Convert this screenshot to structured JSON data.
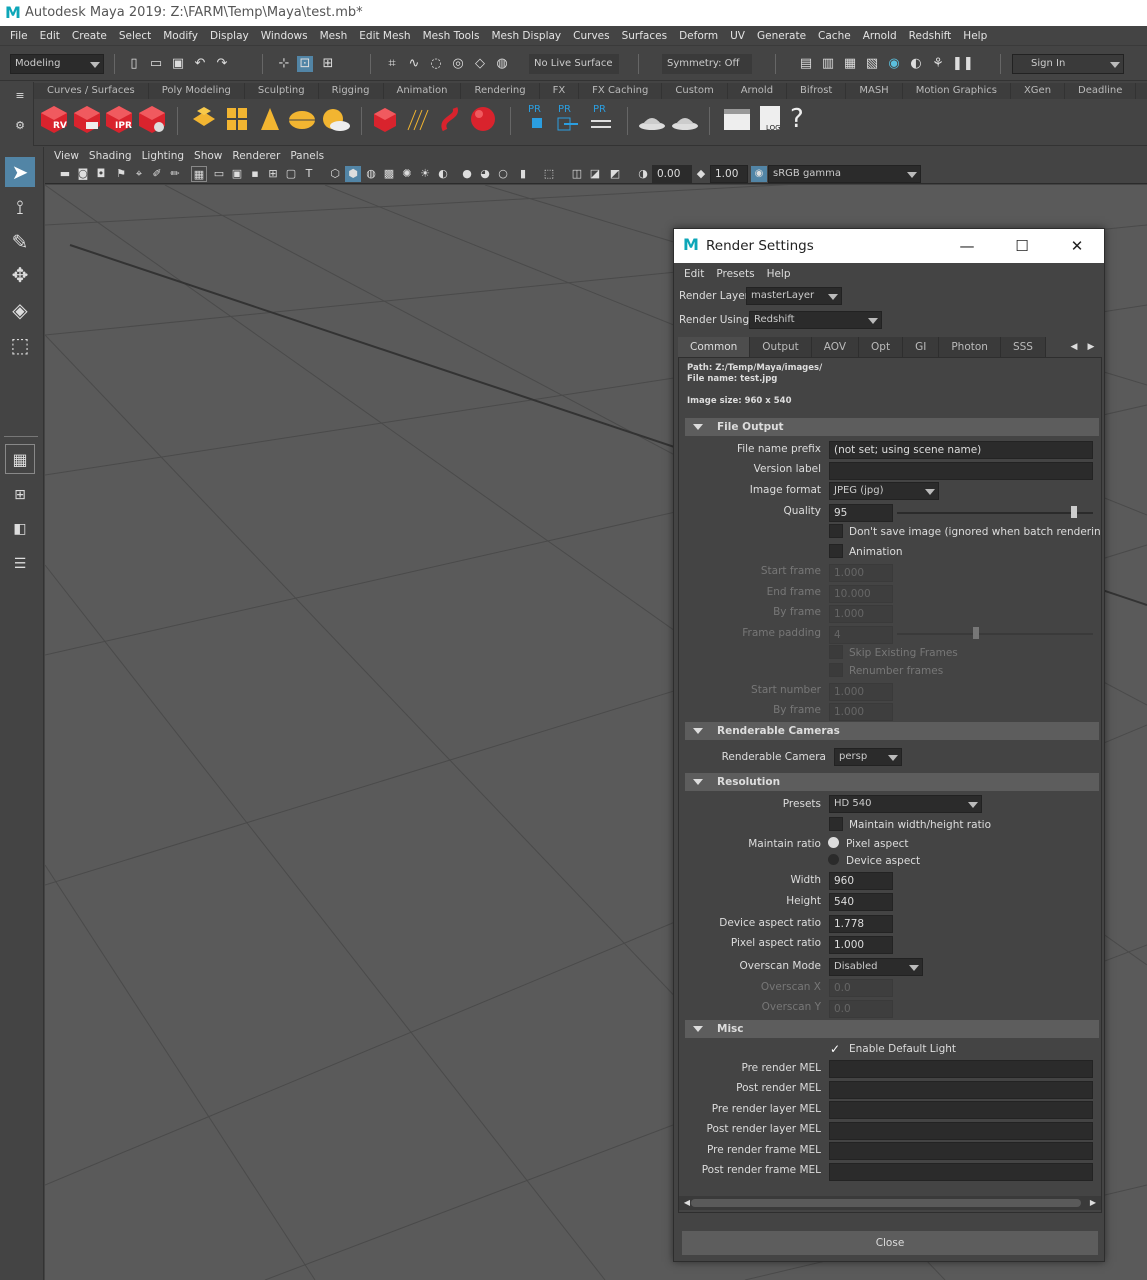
{
  "app": {
    "title": "Autodesk Maya 2019: Z:\\FARM\\Temp\\Maya\\test.mb*",
    "logo": "M"
  },
  "menubar": [
    "File",
    "Edit",
    "Create",
    "Select",
    "Modify",
    "Display",
    "Windows",
    "Mesh",
    "Edit Mesh",
    "Mesh Tools",
    "Mesh Display",
    "Curves",
    "Surfaces",
    "Deform",
    "UV",
    "Generate",
    "Cache",
    "Arnold",
    "Redshift",
    "Help"
  ],
  "statusline": {
    "mode": "Modeling",
    "live_surface": "No Live Surface",
    "symmetry": "Symmetry: Off",
    "sign_in": "Sign In"
  },
  "shelf": {
    "tabs": [
      "Curves / Surfaces",
      "Poly Modeling",
      "Sculpting",
      "Rigging",
      "Animation",
      "Rendering",
      "FX",
      "FX Caching",
      "Custom",
      "Arnold",
      "Bifrost",
      "MASH",
      "Motion Graphics",
      "XGen",
      "Deadline"
    ],
    "labels": {
      "rv": "RV",
      "ipr": "IPR",
      "pr": "PR",
      "log": "LOG",
      "help": "?"
    }
  },
  "panel": {
    "menus": [
      "View",
      "Shading",
      "Lighting",
      "Show",
      "Renderer",
      "Panels"
    ],
    "exposure": "0.00",
    "gamma": "1.00",
    "colorspace": "sRGB gamma"
  },
  "render_settings": {
    "title": "Render Settings",
    "menus": [
      "Edit",
      "Presets",
      "Help"
    ],
    "render_layer_label": "Render Layer",
    "render_layer": "masterLayer",
    "render_using_label": "Render Using",
    "render_using": "Redshift",
    "tabs": [
      "Common",
      "Output",
      "AOV",
      "Opt",
      "GI",
      "Photon",
      "SSS"
    ],
    "path": "Path: Z:/Temp/Maya/images/",
    "file_name": "File name:  test.jpg",
    "image_size": "Image size: 960 x 540",
    "file_output": {
      "header": "File Output",
      "prefix_label": "File name prefix",
      "prefix_value": "(not set; using scene name)",
      "version_label": "Version label",
      "format_label": "Image format",
      "format_value": "JPEG (jpg)",
      "quality_label": "Quality",
      "quality_value": "95",
      "quality_fraction": 0.95,
      "dont_save": "Don't save image (ignored when batch rendering)",
      "animation": "Animation",
      "start_frame_label": "Start frame",
      "start_frame": "1.000",
      "end_frame_label": "End frame",
      "end_frame": "10.000",
      "by_frame_label": "By frame",
      "by_frame": "1.000",
      "frame_padding_label": "Frame padding",
      "frame_padding": "4",
      "skip_existing": "Skip Existing Frames",
      "renumber": "Renumber frames",
      "start_number_label": "Start number",
      "start_number": "1.000",
      "by_frame2_label": "By frame",
      "by_frame2": "1.000"
    },
    "cameras": {
      "header": "Renderable Cameras",
      "label": "Renderable Camera",
      "value": "persp"
    },
    "resolution": {
      "header": "Resolution",
      "presets_label": "Presets",
      "presets_value": "HD 540",
      "maintain_wh": "Maintain width/height ratio",
      "maintain_ratio_label": "Maintain ratio",
      "pixel_aspect": "Pixel aspect",
      "device_aspect": "Device aspect",
      "width_label": "Width",
      "width": "960",
      "height_label": "Height",
      "height": "540",
      "device_ratio_label": "Device aspect ratio",
      "device_ratio": "1.778",
      "pixel_ratio_label": "Pixel aspect ratio",
      "pixel_ratio": "1.000",
      "overscan_mode_label": "Overscan Mode",
      "overscan_mode": "Disabled",
      "overscan_x_label": "Overscan X",
      "overscan_x": "0.0",
      "overscan_y_label": "Overscan Y",
      "overscan_y": "0.0"
    },
    "misc": {
      "header": "Misc",
      "default_light": "Enable Default Light",
      "pre_render": "Pre render MEL",
      "post_render": "Post render MEL",
      "pre_layer": "Pre render layer MEL",
      "post_layer": "Post render layer MEL",
      "pre_frame": "Pre render frame MEL",
      "post_frame": "Post render frame MEL"
    },
    "close": "Close"
  }
}
